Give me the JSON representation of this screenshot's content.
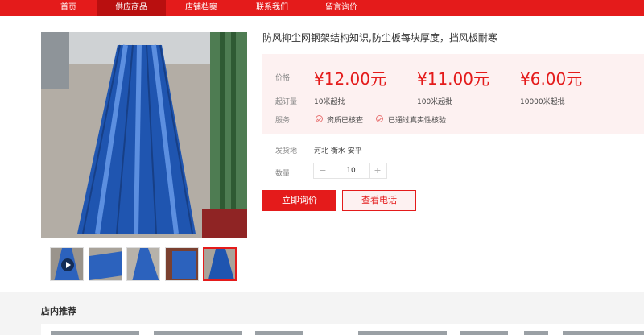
{
  "nav": {
    "items": [
      "首页",
      "供应商品",
      "店铺档案",
      "联系我们",
      "留言询价"
    ],
    "active_index": 1
  },
  "colors": {
    "brand": "#e41b1b",
    "price_bg": "#fdf1f1",
    "panel_blue": "#2b6fd0"
  },
  "gallery": {
    "thumbnails": [
      {
        "name": "video-thumbnail",
        "has_play_icon": true
      },
      {
        "name": "thumbnail-2"
      },
      {
        "name": "thumbnail-3"
      },
      {
        "name": "thumbnail-4"
      },
      {
        "name": "thumbnail-5",
        "selected": true
      }
    ]
  },
  "product": {
    "title": "防风抑尘网钢架结构知识,防尘板每块厚度，挡风板耐寒",
    "price_label": "价格",
    "prices": [
      "¥12.00元",
      "¥11.00元",
      "¥6.00元"
    ],
    "moq_label": "起订量",
    "moqs": [
      "10米起批",
      "100米起批",
      "10000米起批"
    ],
    "service_label": "服务",
    "services": [
      "资质已核查",
      "已通过真实性核验"
    ],
    "origin_label": "发货地",
    "origin": "河北 衡水 安平",
    "quantity_label": "数量",
    "quantity": "10",
    "minus": "−",
    "plus": "+"
  },
  "actions": {
    "inquiry": "立即询价",
    "phone": "查看电话"
  },
  "recommend": {
    "title": "店内推荐"
  }
}
